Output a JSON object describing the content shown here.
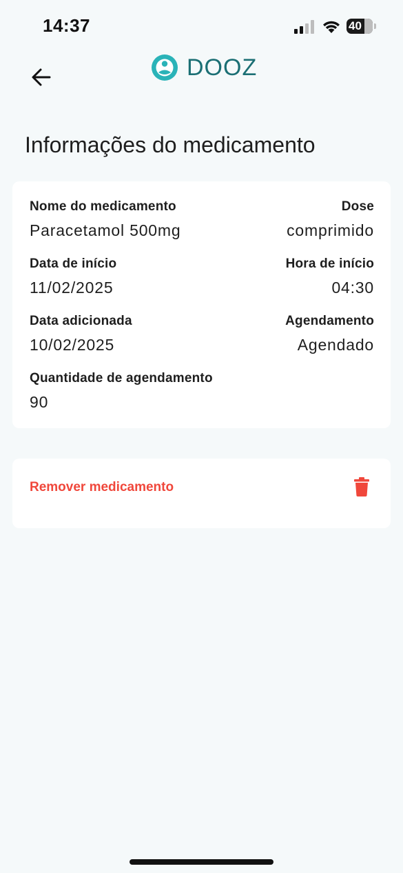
{
  "status_bar": {
    "time": "14:37",
    "battery": "40"
  },
  "header": {
    "brand_name": "DOOZ",
    "brand_color": "#1b6f74",
    "logo_color": "#2ab3b8",
    "back_icon": "arrow-left-icon"
  },
  "page": {
    "title": "Informações do medicamento"
  },
  "info": {
    "medication_name_label": "Nome do medicamento",
    "medication_name_value": "Paracetamol 500mg",
    "dose_label": "Dose",
    "dose_value": "comprimido",
    "start_date_label": "Data de início",
    "start_date_value": "11/02/2025",
    "start_time_label": "Hora de início",
    "start_time_value": "04:30",
    "added_date_label": "Data adicionada",
    "added_date_value": "10/02/2025",
    "schedule_label": "Agendamento",
    "schedule_value": "Agendado",
    "schedule_qty_label": "Quantidade de agendamento",
    "schedule_qty_value": "90"
  },
  "actions": {
    "remove_label": "Remover medicamento",
    "remove_icon": "trash-icon",
    "danger_color": "#f0473b"
  }
}
